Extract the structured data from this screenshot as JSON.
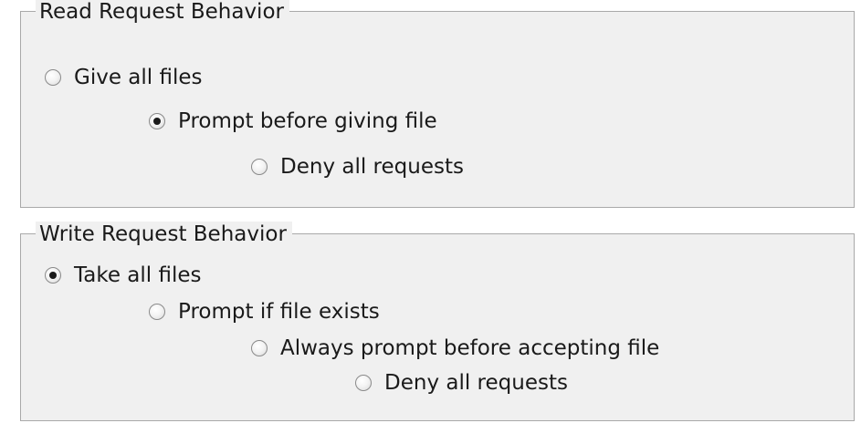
{
  "read_group": {
    "title": "Read Request Behavior",
    "options": [
      {
        "label": "Give all files",
        "checked": false
      },
      {
        "label": "Prompt before giving file",
        "checked": true
      },
      {
        "label": "Deny all requests",
        "checked": false
      }
    ]
  },
  "write_group": {
    "title": "Write Request Behavior",
    "options": [
      {
        "label": "Take all files",
        "checked": true
      },
      {
        "label": "Prompt if file exists",
        "checked": false
      },
      {
        "label": "Always prompt before accepting file",
        "checked": false
      },
      {
        "label": "Deny all requests",
        "checked": false
      }
    ]
  }
}
